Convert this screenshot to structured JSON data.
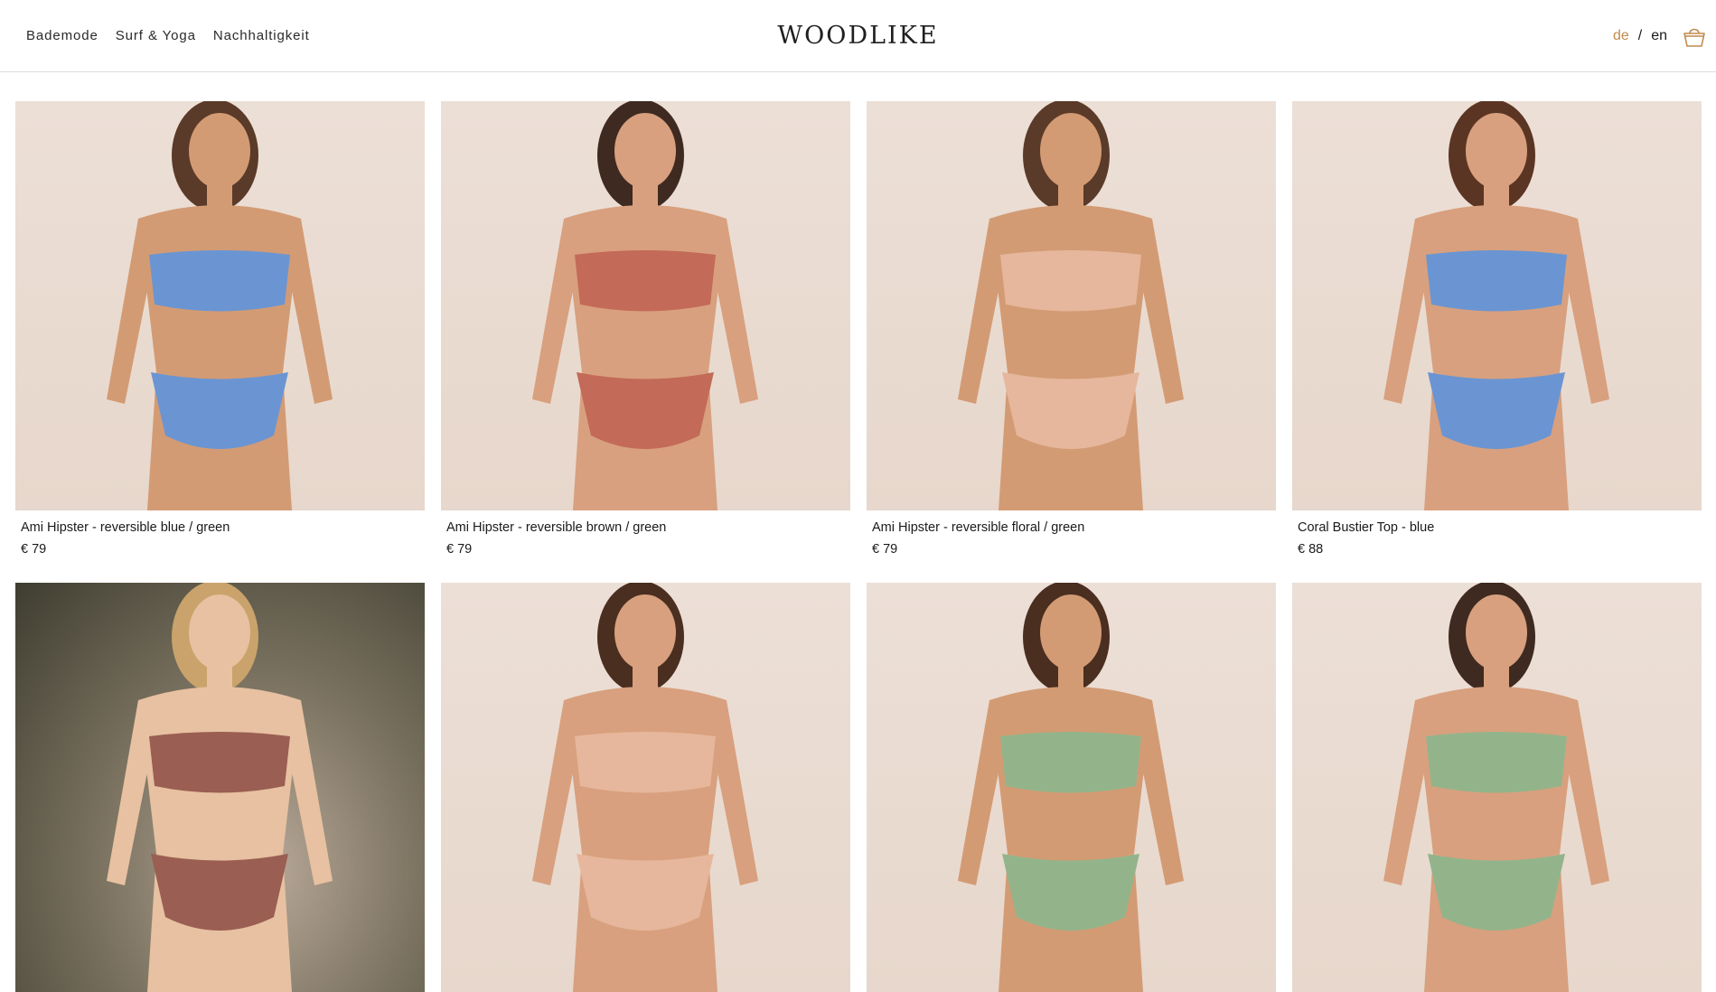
{
  "nav": {
    "items": [
      "Bademode",
      "Surf & Yoga",
      "Nachhaltigkeit"
    ]
  },
  "logo": "WOODLIKE",
  "lang": {
    "active": "de",
    "separator": "/",
    "other": "en"
  },
  "icons": {
    "cart": "shopping-basket-icon"
  },
  "colors": {
    "accent": "#c08a4f",
    "border": "#dcdcdc"
  },
  "products": [
    {
      "title": "Ami Hipster - reversible blue / green",
      "price": "€ 79",
      "swim": "#6a95d2",
      "skin": "#d39b74",
      "hair": "#5a3a28"
    },
    {
      "title": "Ami Hipster - reversible brown / green",
      "price": "€ 79",
      "swim": "#c36a58",
      "skin": "#d8a07e",
      "hair": "#3e2a20"
    },
    {
      "title": "Ami Hipster - reversible floral / green",
      "price": "€ 79",
      "swim": "#e6b79c",
      "skin": "#d39b74",
      "hair": "#5a3a28"
    },
    {
      "title": "Coral Bustier Top - blue",
      "price": "€ 88",
      "swim": "#6a95d2",
      "skin": "#d8a07e",
      "hair": "#5b3523"
    },
    {
      "title": "",
      "price": "",
      "swim": "#9a5e52",
      "skin": "#e7c1a1",
      "hair": "#c9a36b"
    },
    {
      "title": "",
      "price": "",
      "swim": "#e6b79c",
      "skin": "#d8a07e",
      "hair": "#4a2e20"
    },
    {
      "title": "",
      "price": "",
      "swim": "#93b48a",
      "skin": "#d39b74",
      "hair": "#4a2e20"
    },
    {
      "title": "",
      "price": "",
      "swim": "#93b48a",
      "skin": "#d8a07e",
      "hair": "#3e2a20"
    }
  ]
}
